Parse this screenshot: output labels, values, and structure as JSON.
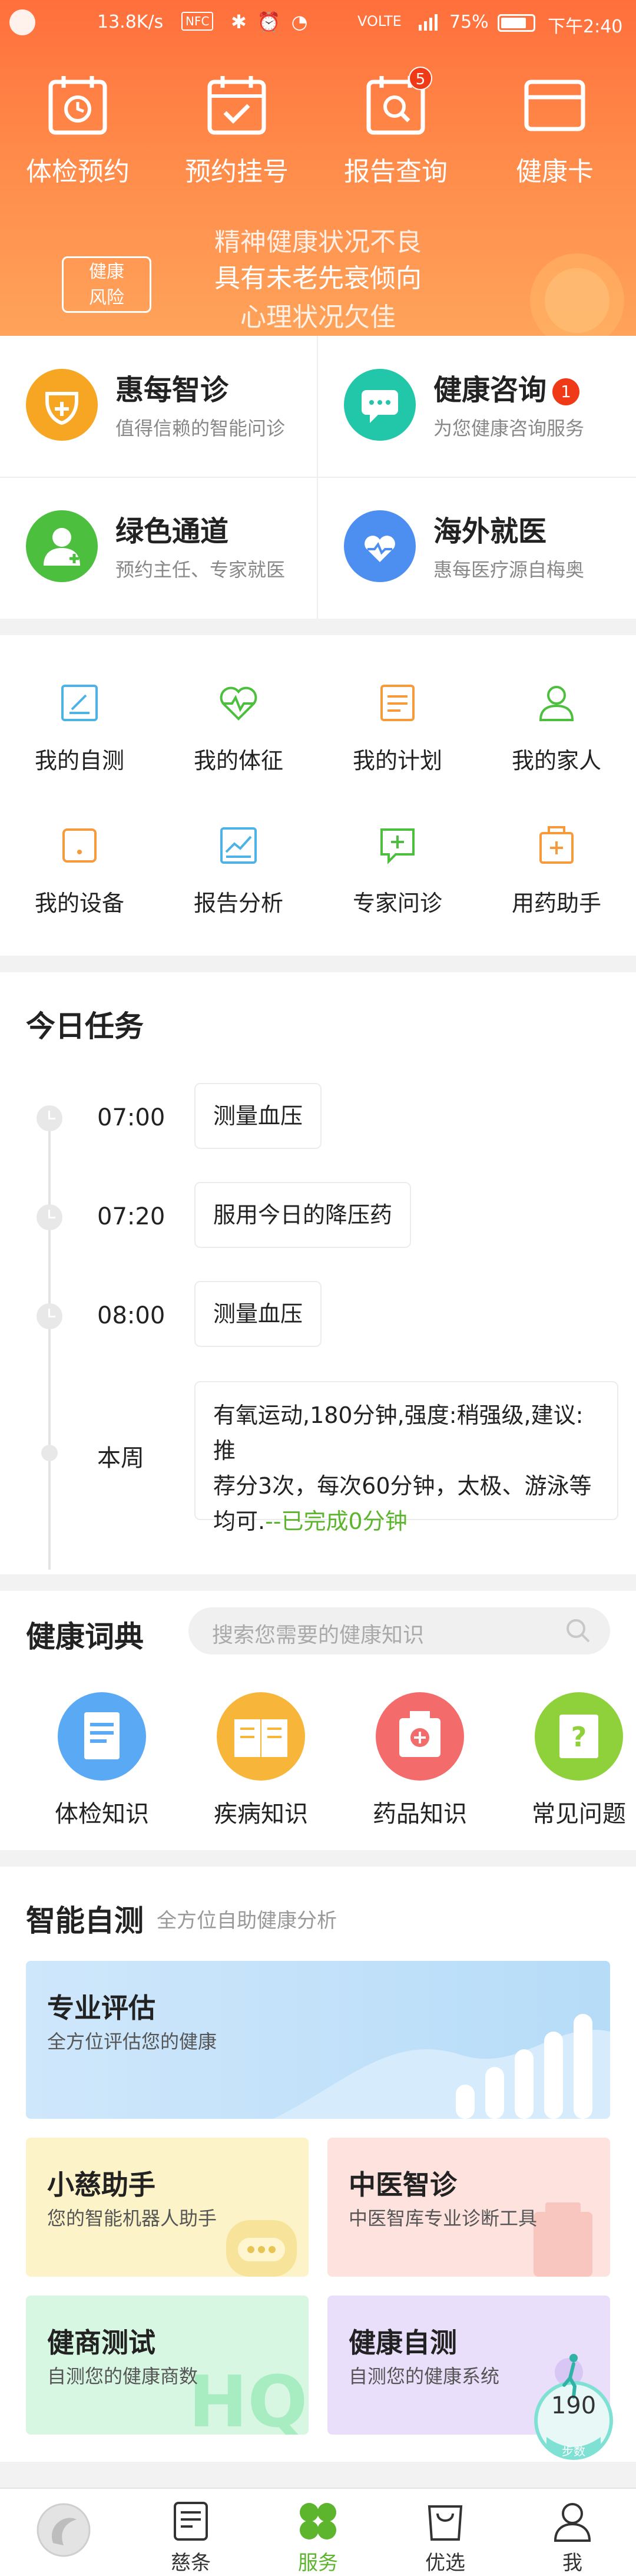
{
  "status_bar": {
    "speed": "13.8K/s",
    "nfc": "NFC",
    "volte": "VOLTE",
    "battery": "75%",
    "time": "下午2:40"
  },
  "top_nav": [
    {
      "label": "体检预约",
      "icon": "calendar-clock-icon"
    },
    {
      "label": "预约挂号",
      "icon": "calendar-check-icon"
    },
    {
      "label": "报告查询",
      "icon": "report-search-icon",
      "badge": "5"
    },
    {
      "label": "健康卡",
      "icon": "card-icon"
    }
  ],
  "banner": {
    "tag": "健康\n风险",
    "lines": [
      "精神健康状况不良",
      "具有未老先衰倾向",
      "心理状况欠佳"
    ]
  },
  "quick_services": [
    {
      "title": "惠每智诊",
      "subtitle": "值得信赖的智能问诊",
      "icon": "medical-kit-icon",
      "color": "#f7a623"
    },
    {
      "title": "健康咨询",
      "subtitle": "为您健康咨询服务",
      "icon": "chat-bubble-icon",
      "color": "#22c6a8",
      "badge": "1"
    },
    {
      "title": "绿色通道",
      "subtitle": "预约主任、专家就医",
      "icon": "doctor-icon",
      "color": "#4cbf3f"
    },
    {
      "title": "海外就医",
      "subtitle": "惠每医疗源自梅奥",
      "icon": "heart-hand-icon",
      "color": "#4d8ff0"
    }
  ],
  "feature_grid": [
    {
      "label": "我的自测",
      "icon": "self-test-icon"
    },
    {
      "label": "我的体征",
      "icon": "heartbeat-icon"
    },
    {
      "label": "我的计划",
      "icon": "plan-icon"
    },
    {
      "label": "我的家人",
      "icon": "family-icon"
    },
    {
      "label": "我的设备",
      "icon": "device-icon"
    },
    {
      "label": "报告分析",
      "icon": "chart-analysis-icon"
    },
    {
      "label": "专家问诊",
      "icon": "consult-icon"
    },
    {
      "label": "用药助手",
      "icon": "medicine-icon"
    }
  ],
  "today_tasks": {
    "title": "今日任务",
    "items": [
      {
        "time": "07:00",
        "text": "测量血压"
      },
      {
        "time": "07:20",
        "text": "服用今日的降压药"
      },
      {
        "time": "08:00",
        "text": "测量血压"
      },
      {
        "time": "本周",
        "text_lines": [
          "有氧运动,180分钟,强度:稍强级,建议:推",
          "荐分3次，每次60分钟，太极、游泳等"
        ],
        "text_tail": "均可.",
        "progress": "--已完成0分钟"
      }
    ]
  },
  "dictionary": {
    "title": "健康词典",
    "placeholder": "搜索您需要的健康知识",
    "items": [
      {
        "label": "体检知识",
        "icon": "checkup-doc-icon",
        "color": "#5aa9f5"
      },
      {
        "label": "疾病知识",
        "icon": "book-icon",
        "color": "#f7b53a"
      },
      {
        "label": "药品知识",
        "icon": "medicine-box-icon",
        "color": "#f36b6b"
      },
      {
        "label": "常见问题",
        "icon": "question-icon",
        "color": "#8fd13b"
      }
    ]
  },
  "smart_test": {
    "title": "智能自测",
    "subtitle": "全方位自助健康分析",
    "tiles": [
      {
        "title": "专业评估",
        "subtitle": "全方位评估您的健康"
      },
      {
        "title": "小慈助手",
        "subtitle": "您的智能机器人助手"
      },
      {
        "title": "中医智诊",
        "subtitle": "中医智库专业诊断工具"
      },
      {
        "title": "健商测试",
        "subtitle": "自测您的健康商数"
      },
      {
        "title": "健康自测",
        "subtitle": "自测您的健康系统"
      }
    ]
  },
  "step_widget": {
    "value": "190",
    "label": "步数"
  },
  "tab_bar": [
    {
      "label": "",
      "icon": "app-logo-icon"
    },
    {
      "label": "慈条",
      "icon": "document-icon"
    },
    {
      "label": "服务",
      "icon": "clover-icon",
      "active": true
    },
    {
      "label": "优选",
      "icon": "shopping-bag-icon"
    },
    {
      "label": "我",
      "icon": "user-icon"
    }
  ]
}
